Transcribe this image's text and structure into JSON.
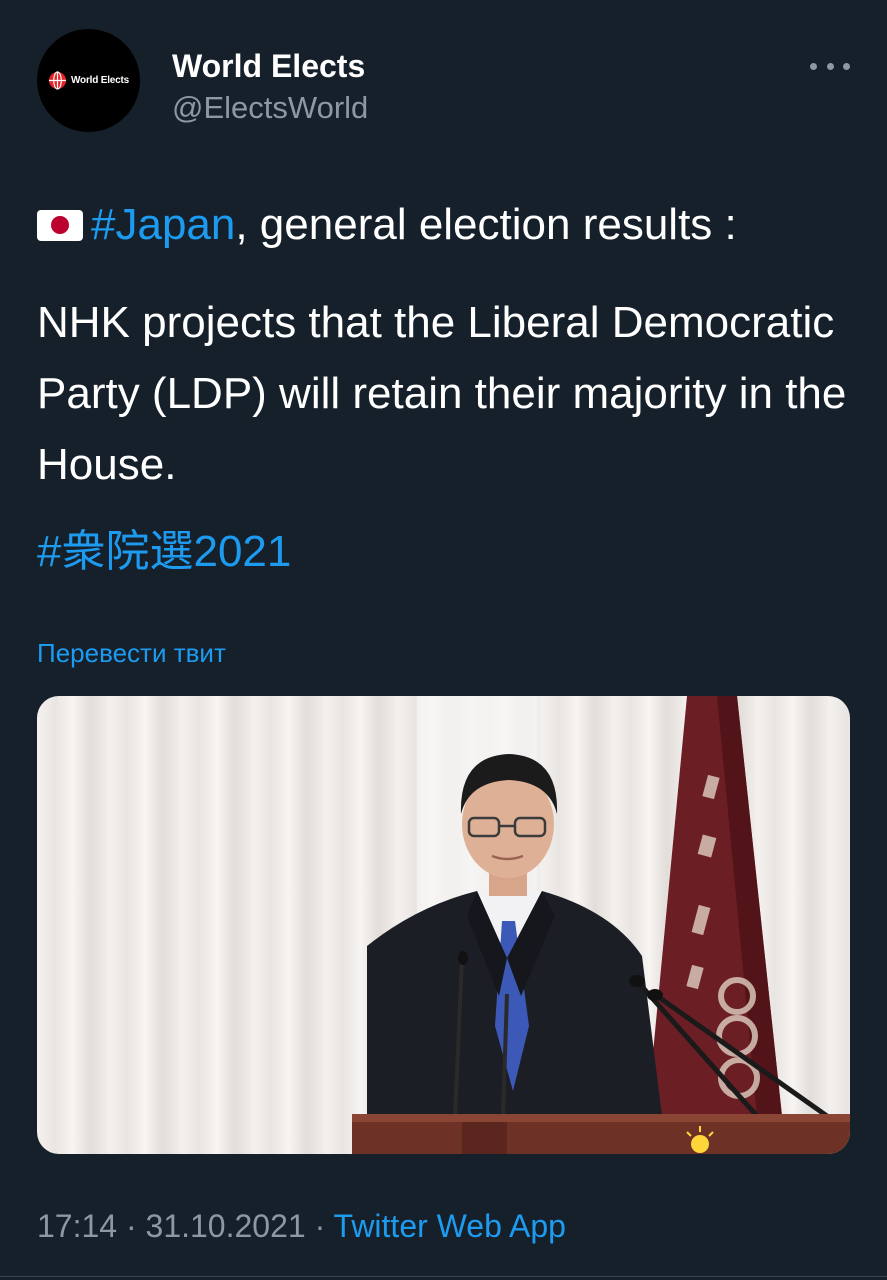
{
  "author": {
    "avatar_text": "World Elects",
    "name": "World Elects",
    "handle": "@ElectsWorld"
  },
  "more_icon": "more-horizontal-icon",
  "tweet": {
    "flag_icon": "japan-flag-icon",
    "hashtag_japan": "#Japan",
    "headline_rest": ", general election results :",
    "body": "NHK projects that the Liberal Democratic Party (LDP) will retain their majority in the House.",
    "hashtag_election": "#衆院選2021"
  },
  "translate_label": "Перевести твит",
  "meta": {
    "time": "17:14",
    "separator": " · ",
    "date": "31.10.2021",
    "app": "Twitter Web App"
  },
  "colors": {
    "background": "#15202b",
    "link": "#1d9bf0",
    "secondary_text": "#8b98a5",
    "flag_red": "#bc002d"
  }
}
